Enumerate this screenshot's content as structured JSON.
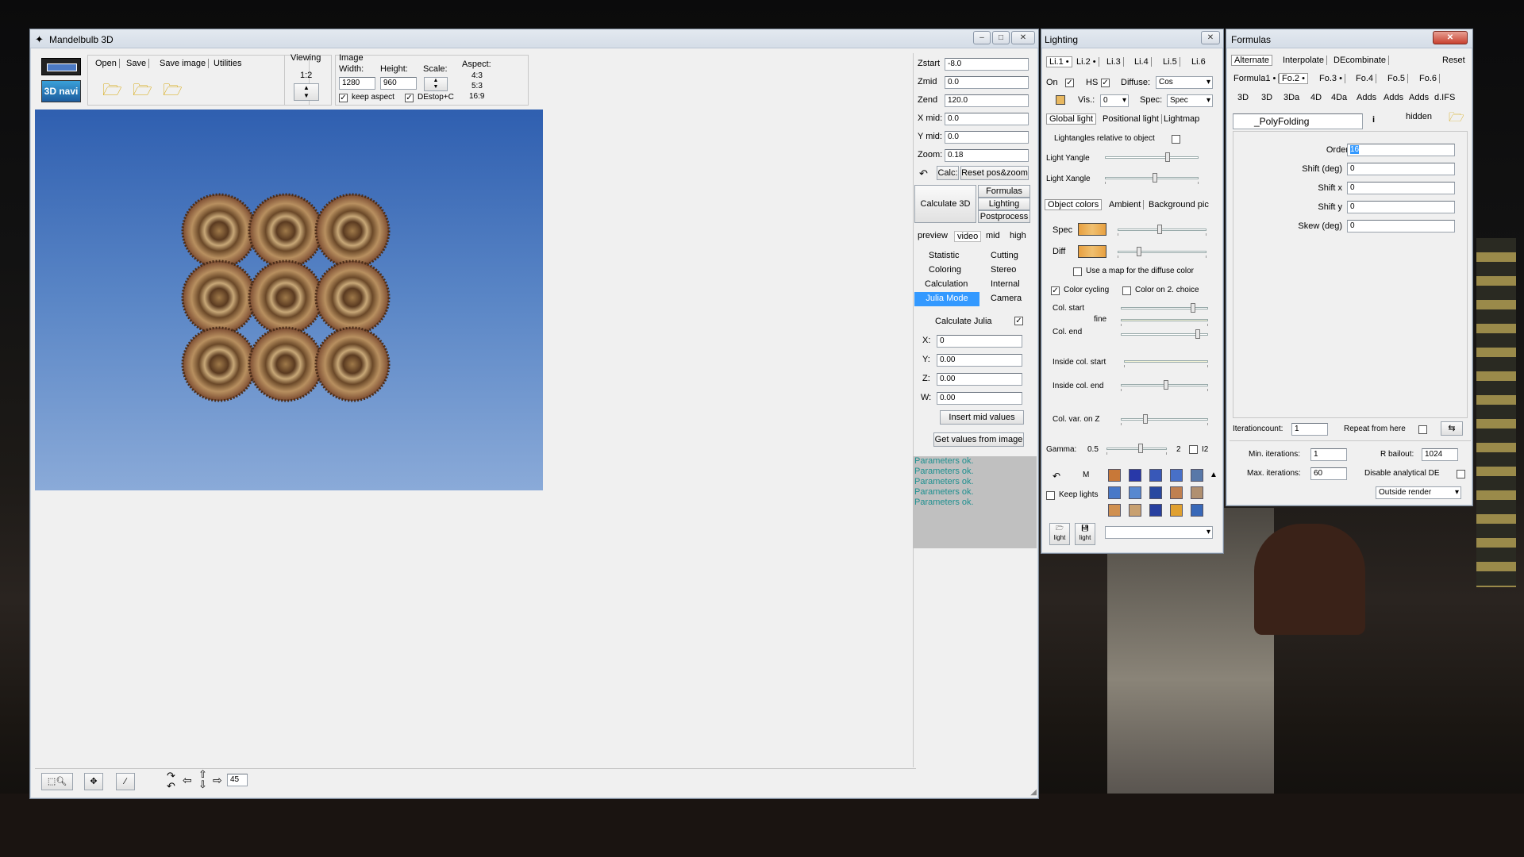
{
  "main_window": {
    "title": "Mandelbulb 3D",
    "menu": [
      "Open",
      "Save",
      "Save image",
      "Utilities"
    ],
    "nav_label": "3D navi",
    "viewing": {
      "label": "Viewing",
      "value": "1:2"
    },
    "image": {
      "label": "Image",
      "width_label": "Width:",
      "height_label": "Height:",
      "scale_label": "Scale:",
      "aspect_label": "Aspect:",
      "width": "1280",
      "height": "960",
      "keep_aspect": "keep aspect",
      "destop": "DEstop+C",
      "aspects": [
        "4:3",
        "5:3",
        "16:9"
      ]
    },
    "coords": [
      {
        "label": "Zstart",
        "value": "-8.0"
      },
      {
        "label": "Zmid",
        "value": "0.0"
      },
      {
        "label": "Zend",
        "value": "120.0"
      },
      {
        "label": "X mid:",
        "value": "0.0"
      },
      {
        "label": "Y mid:",
        "value": "0.0"
      },
      {
        "label": "Zoom:",
        "value": "0.18"
      }
    ],
    "calc_btn": "Calc:",
    "reset_btn": "Reset pos&zoom",
    "calculate3d": "Calculate 3D",
    "side_btns": [
      "Formulas",
      "Lighting",
      "Postprocess"
    ],
    "quality": [
      "preview",
      "video",
      "mid",
      "high"
    ],
    "tabs": [
      "Statistic",
      "Cutting",
      "Coloring",
      "Stereo",
      "Calculation",
      "Internal",
      "Julia Mode",
      "Camera"
    ],
    "julia": {
      "label": "Calculate Julia",
      "fields": [
        {
          "label": "X:",
          "value": "0"
        },
        {
          "label": "Y:",
          "value": "0.00"
        },
        {
          "label": "Z:",
          "value": "0.00"
        },
        {
          "label": "W:",
          "value": "0.00"
        }
      ],
      "insert_btn": "Insert mid values",
      "get_btn": "Get values from image"
    },
    "status": [
      "Parameters ok.",
      "Parameters ok.",
      "Parameters ok.",
      "Parameters ok.",
      "Parameters ok."
    ],
    "step_value": "45"
  },
  "lighting": {
    "title": "Lighting",
    "lights": [
      "Li.1 •",
      "Li.2 •",
      "Li.3",
      "Li.4",
      "Li.5",
      "Li.6"
    ],
    "on": "On",
    "hs": "HS",
    "diffuse_label": "Diffuse:",
    "diffuse": "Cos",
    "vis_label": "Vis.:",
    "vis": "0",
    "spec_label": "Spec:",
    "spec": "Spec",
    "tabs": [
      "Global light",
      "Positional light",
      "Lightmap"
    ],
    "relative": "Lightangles relative to object",
    "yangle": "Light Yangle",
    "xangle": "Light Xangle",
    "color_tabs": [
      "Object colors",
      "Ambient",
      "Background pic"
    ],
    "diff": "Diff",
    "use_map": "Use a map for the diffuse color",
    "color_cycling": "Color cycling",
    "color_on2": "Color on 2. choice",
    "col_start": "Col. start",
    "fine": "fine",
    "col_end": "Col. end",
    "inside_start": "Inside col. start",
    "inside_end": "Inside col. end",
    "col_var": "Col. var. on Z",
    "gamma_label": "Gamma:",
    "gamma": "0.5",
    "gamma2": "2",
    "i2": "I2",
    "m_label": "M",
    "keep_lights": "Keep lights",
    "light": "light"
  },
  "formulas": {
    "title": "Formulas",
    "top_tabs": [
      "Alternate",
      "Interpolate",
      "DEcombinate"
    ],
    "reset": "Reset",
    "formula_tabs": [
      "Formula1 •",
      "Fo.2 •",
      "Fo.3 •",
      "Fo.4",
      "Fo.5",
      "Fo.6"
    ],
    "types": [
      "3D",
      "3D",
      "3Da",
      "4D",
      "4Da",
      "Adds",
      "Adds",
      "Adds",
      "d.IFS"
    ],
    "name": "_PolyFolding",
    "info": "i",
    "hidden": "hidden",
    "params": [
      {
        "label": "Order",
        "value": "16"
      },
      {
        "label": "Shift (deg)",
        "value": "0"
      },
      {
        "label": "Shift x",
        "value": "0"
      },
      {
        "label": "Shift y",
        "value": "0"
      },
      {
        "label": "Skew (deg)",
        "value": "0"
      }
    ],
    "iterationcount_label": "Iterationcount:",
    "iterationcount": "1",
    "repeat": "Repeat from here",
    "min_iter_label": "Min. iterations:",
    "min_iter": "1",
    "max_iter_label": "Max. iterations:",
    "max_iter": "60",
    "rbailout_label": "R bailout:",
    "rbailout": "1024",
    "disable_de": "Disable analytical DE",
    "render_mode": "Outside render"
  }
}
